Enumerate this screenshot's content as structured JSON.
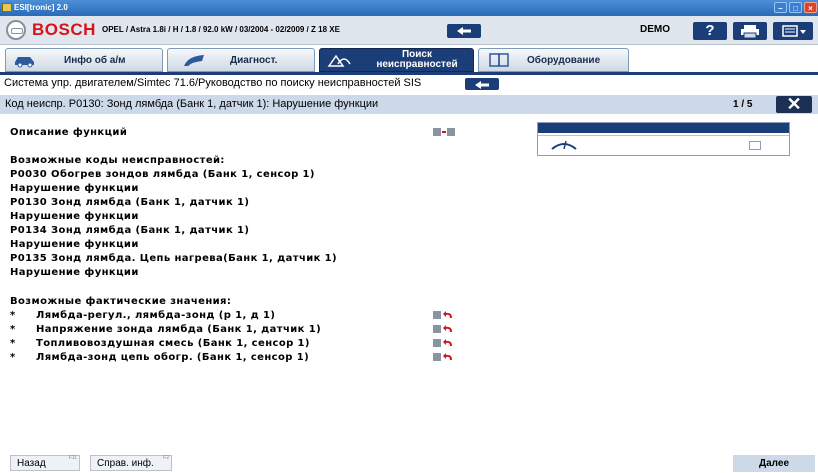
{
  "window": {
    "title": "ESI[tronic] 2.0"
  },
  "header": {
    "brand": "BOSCH",
    "vehicle_prefix": "OPEL / Astra 1.8i / H / 1.8 / 92.0 kW / 03/2004 - 02/2009 / Z 18 XE",
    "mode": "DEMO",
    "help_label": "?"
  },
  "tabs": [
    {
      "label": "Инфо об а/м",
      "icon": "car-icon"
    },
    {
      "label": "Диагност.",
      "icon": "diagnostic-icon"
    },
    {
      "label_line1": "Поиск",
      "label_line2": "неисправностей",
      "icon": "search-fault-icon",
      "active": true
    },
    {
      "label": "Оборудование",
      "icon": "book-icon"
    }
  ],
  "breadcrumb": "Система упр. двигателем/Simtec 71.6/Руководство по поиску неисправностей SIS",
  "fault": {
    "title": "Код неиспр. P0130: Зонд лямбда (Банк 1, датчик 1): Нарушение функции",
    "page": "1 / 5"
  },
  "content": {
    "function_description": "Описание функций",
    "possible_codes_heading": "Возможные коды неисправностей:",
    "codes": [
      "P0030 Обогрев зондов лямбда (Банк 1, сенсор 1)",
      "Нарушение функции",
      "P0130 Зонд лямбда (Банк 1, датчик 1)",
      "Нарушение функции",
      "P0134 Зонд лямбда (Банк 1, датчик 1)",
      "Нарушение функции",
      "P0135 Зонд лямбда.  Цепь нагрева(Банк 1, датчик 1)",
      "Нарушение функции"
    ],
    "actual_values_heading": "Возможные фактические значения:",
    "actual_values": [
      {
        "bullet": "*",
        "text": "Лямбда-регул., лямбда-зонд (р 1, д 1)"
      },
      {
        "bullet": "*",
        "text": "Напряжение зонда лямбда (Банк 1, датчик 1)"
      },
      {
        "bullet": "*",
        "text": "Топливовоздушная смесь (Банк 1, сенсор 1)"
      },
      {
        "bullet": "*",
        "text": "Лямбда-зонд цепь обогр. (Банк 1, сенсор 1)"
      }
    ]
  },
  "footer": {
    "back_label": "Назад",
    "back_key": "F11",
    "help_info_label": "Справ. инф.",
    "help_info_key": "F2",
    "next_label": "Далее"
  },
  "colors": {
    "accent_dark": "#1c3e78",
    "light_bar": "#cbd9e8",
    "brand_red": "#d6131b"
  }
}
